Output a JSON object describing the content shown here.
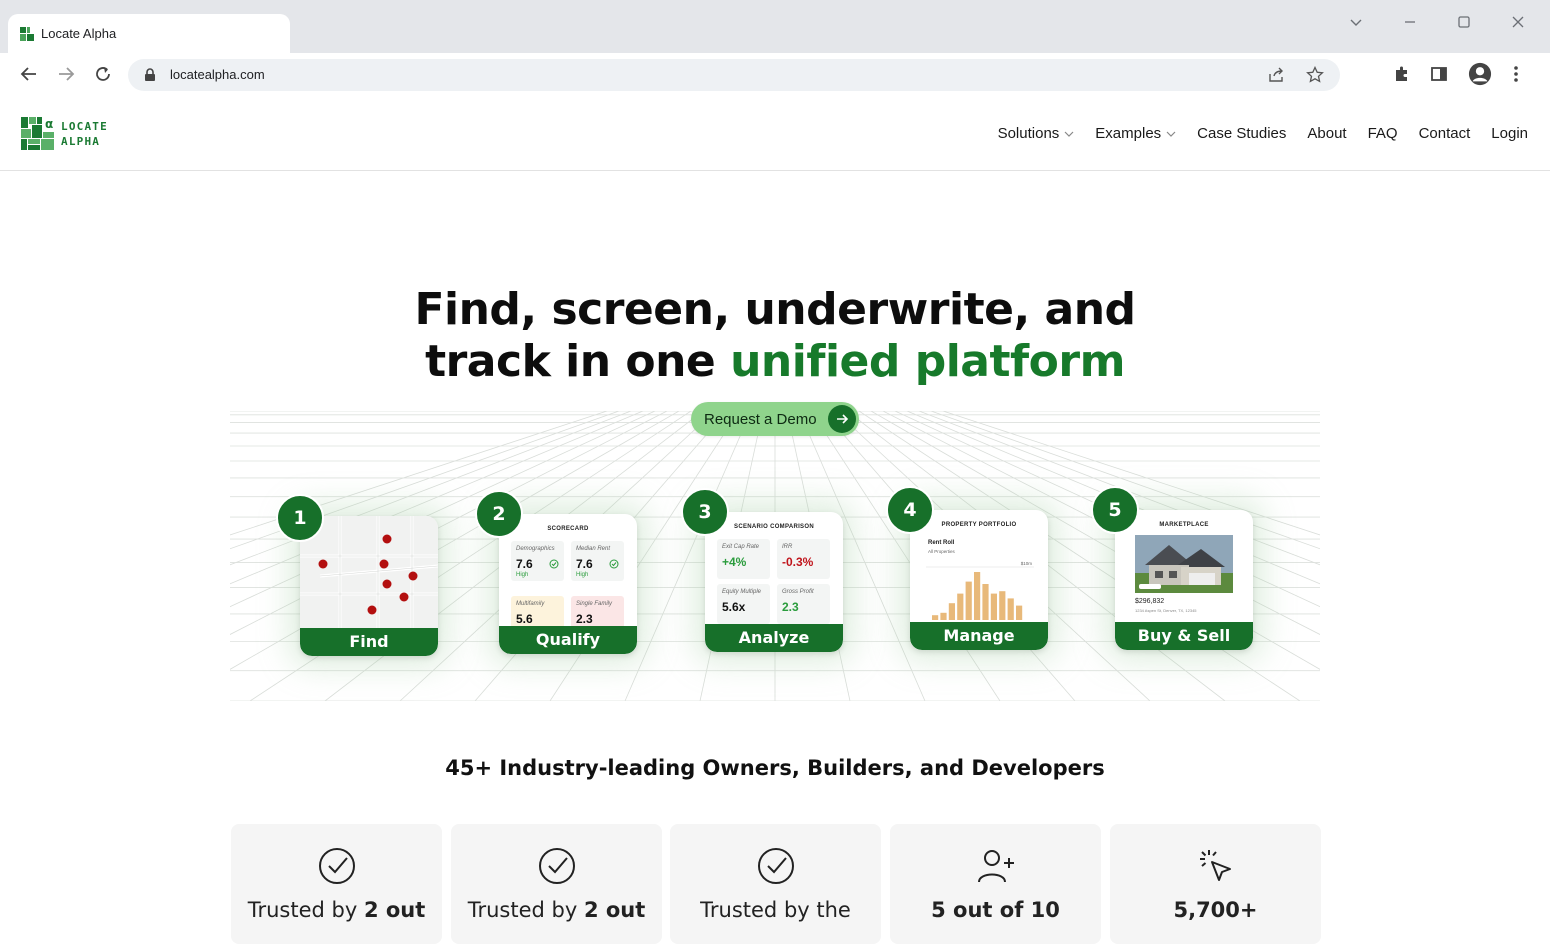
{
  "browser": {
    "tab_title": "Locate Alpha",
    "url": "locatealpha.com"
  },
  "site": {
    "logo_line1": "LOCATE",
    "logo_line2": "ALPHA",
    "nav": [
      {
        "label": "Solutions",
        "dropdown": true
      },
      {
        "label": "Examples",
        "dropdown": true
      },
      {
        "label": "Case Studies",
        "dropdown": false
      },
      {
        "label": "About",
        "dropdown": false
      },
      {
        "label": "FAQ",
        "dropdown": false
      },
      {
        "label": "Contact",
        "dropdown": false
      },
      {
        "label": "Login",
        "dropdown": false
      }
    ]
  },
  "hero": {
    "headline_line1": "Find, screen, underwrite, and",
    "headline_line2_plain": "track in one ",
    "headline_line2_accent": "unified platform",
    "cta": "Request a Demo",
    "accent_color": "#177a2b"
  },
  "steps": [
    {
      "number": "1",
      "label": "Find"
    },
    {
      "number": "2",
      "label": "Qualify",
      "card_title": "SCORECARD",
      "cells": [
        {
          "label": "Demographics",
          "value": "7.6",
          "sub": "High"
        },
        {
          "label": "Median Rent",
          "value": "7.6",
          "sub": "High"
        },
        {
          "label": "Multifamily",
          "value": "5.6"
        },
        {
          "label": "Single Family",
          "value": "2.3"
        }
      ]
    },
    {
      "number": "3",
      "label": "Analyze",
      "card_title": "SCENARIO COMPARISON",
      "cells": [
        {
          "label": "Exit Cap Rate",
          "value": "+4%"
        },
        {
          "label": "IRR",
          "value": "-0.3%"
        },
        {
          "label": "Equity Multiple",
          "value": "5.6x"
        },
        {
          "label": "Gross Profit",
          "value": "2.3"
        }
      ]
    },
    {
      "number": "4",
      "label": "Manage",
      "card_title": "PROPERTY PORTFOLIO",
      "chart_title": "Rent Roll",
      "chart_sub": "All Properties",
      "chart_axis": "$10m",
      "bars": [
        0.1,
        0.15,
        0.35,
        0.55,
        0.8,
        1.0,
        0.75,
        0.55,
        0.6,
        0.45,
        0.3
      ]
    },
    {
      "number": "5",
      "label": "Buy & Sell",
      "card_title": "MARKETPLACE",
      "price": "$296,832",
      "address": "1234 Aspen St, Denver, TX, 12345"
    }
  ],
  "section_title": "45+ Industry-leading Owners, Builders, and Developers",
  "stats": [
    {
      "icon": "check-circle-icon",
      "text_plain": "Trusted by ",
      "text_bold": "2 out"
    },
    {
      "icon": "check-circle-icon",
      "text_plain": "Trusted by ",
      "text_bold": "2 out"
    },
    {
      "icon": "check-circle-icon",
      "text_plain": "Trusted by the",
      "text_bold": ""
    },
    {
      "icon": "user-plus-icon",
      "text_plain": "",
      "text_bold": "5 out of 10"
    },
    {
      "icon": "cursor-click-icon",
      "text_plain": "",
      "text_bold": "5,700+"
    }
  ]
}
